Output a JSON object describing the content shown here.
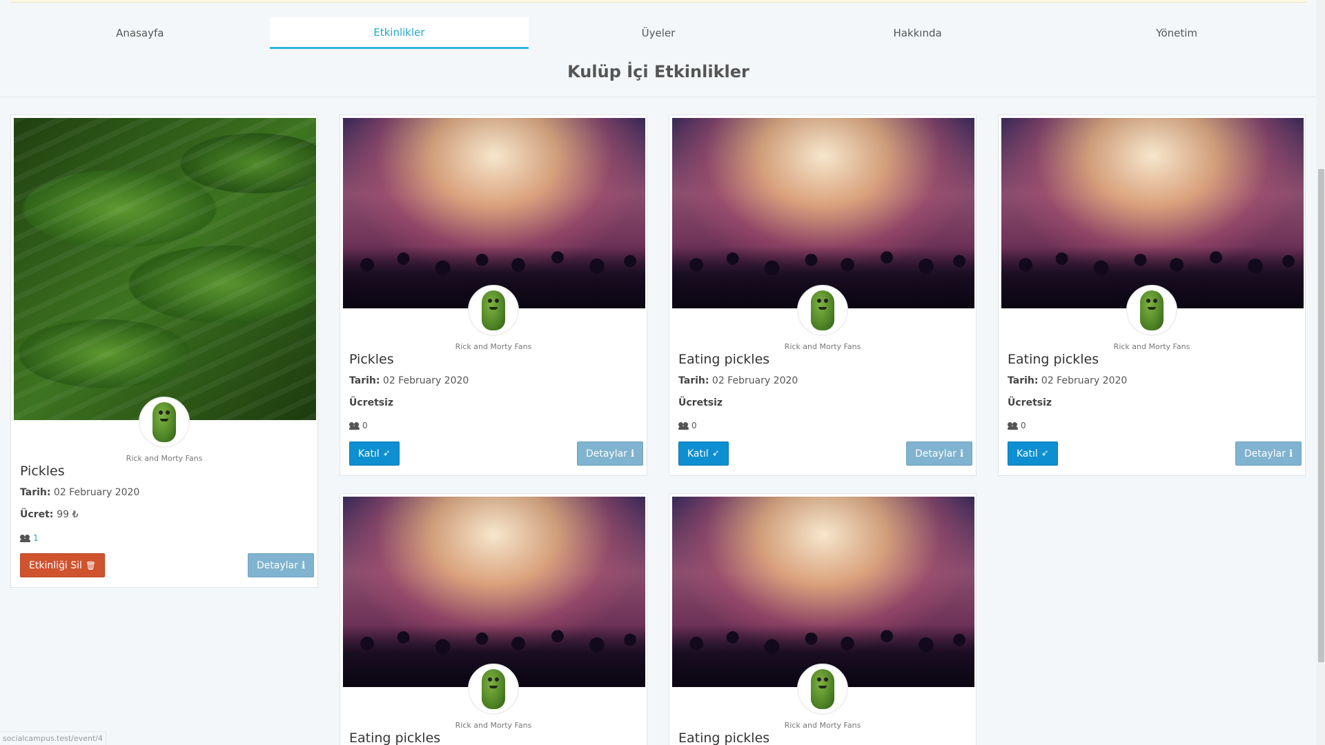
{
  "nav": {
    "tabs": [
      {
        "label": "Anasayfa"
      },
      {
        "label": "Etkinlikler"
      },
      {
        "label": "Üyeler"
      },
      {
        "label": "Hakkında"
      },
      {
        "label": "Yönetim"
      }
    ],
    "active_index": 1
  },
  "page_title": "Kulüp İçi Etkinlikler",
  "labels": {
    "date_label": "Tarih:",
    "price_label": "Ücret:",
    "join_button": "Katıl",
    "details_button": "Detaylar",
    "delete_button": "Etkinliği Sil"
  },
  "events": [
    {
      "club": "Rick and Morty Fans",
      "title": "Pickles",
      "date": "02 February 2020",
      "price": "99 ₺",
      "attendees": "1",
      "image": "pickles-photo",
      "owner": true
    },
    {
      "club": "Rick and Morty Fans",
      "title": "Pickles",
      "date": "02 February 2020",
      "price": "Ücretsiz",
      "attendees": "0",
      "image": "concert-photo",
      "owner": false
    },
    {
      "club": "Rick and Morty Fans",
      "title": "Eating pickles",
      "date": "02 February 2020",
      "price": "Ücretsiz",
      "attendees": "0",
      "image": "concert-photo",
      "owner": false
    },
    {
      "club": "Rick and Morty Fans",
      "title": "Eating pickles",
      "date": "02 February 2020",
      "price": "Ücretsiz",
      "attendees": "0",
      "image": "concert-photo",
      "owner": false
    },
    {
      "club": "Rick and Morty Fans",
      "title": "Eating pickles",
      "image": "concert-photo"
    },
    {
      "club": "Rick and Morty Fans",
      "title": "Eating pickles",
      "image": "concert-photo"
    }
  ],
  "status_bar_url": "socialcampus.test/event/4",
  "colors": {
    "accent": "#2bb7e0",
    "primary_button": "#0d8fd1",
    "info_button": "#7fb3cf",
    "danger_button": "#d0532f",
    "background": "#f4f7f9"
  },
  "icons": {
    "join": "paper-plane-icon",
    "details": "info-icon",
    "delete": "trash-icon",
    "attendees": "users-icon"
  }
}
